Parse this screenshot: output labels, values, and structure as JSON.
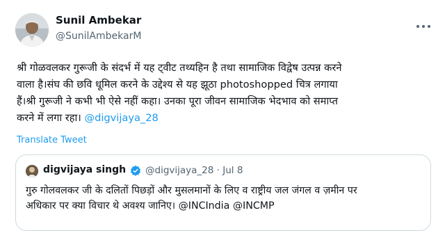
{
  "author": {
    "name": "Sunil Ambekar",
    "handle": "@SunilAmbekarM"
  },
  "tweet": {
    "text": "श्री गोळवलकर गुरूजी के संदर्भ में यह ट्वीट तथ्यहिन है तथा सामाजिक विद्वेष उत्पन्न करने\nवाला है।संघ की छवि धूमिल करने के उद्देश्य से यह  झूठा photoshopped चित्र लगाया\nहैं।श्री गुरूजी ने कभी भी ऐसे नहीं कहा। उनका पूरा जीवन सामाजिक भेदभाव को समाप्त\nकरने में लगा रहा।",
    "mention": "@digvijaya_28"
  },
  "translate_label": "Translate Tweet",
  "more_icon": "more-horizontal-icon",
  "quoted": {
    "name": "digvijaya singh",
    "handle": "@digvijaya_28",
    "separator": "·",
    "date": "Jul 8",
    "text": "गुरु गोलवलकर जी के दलितों पिछड़ों और मुसलमानों के लिए व राष्ट्रीय जल जंगल व ज़मीन पर\nअधिकार पर क्या विचार थे अवश्य जानिए। @INCIndia @INCMP"
  },
  "colors": {
    "link": "#1d9bf0",
    "secondary_text": "#536471",
    "border": "#cfd9de",
    "verified_badge": "#1d9bf0"
  }
}
